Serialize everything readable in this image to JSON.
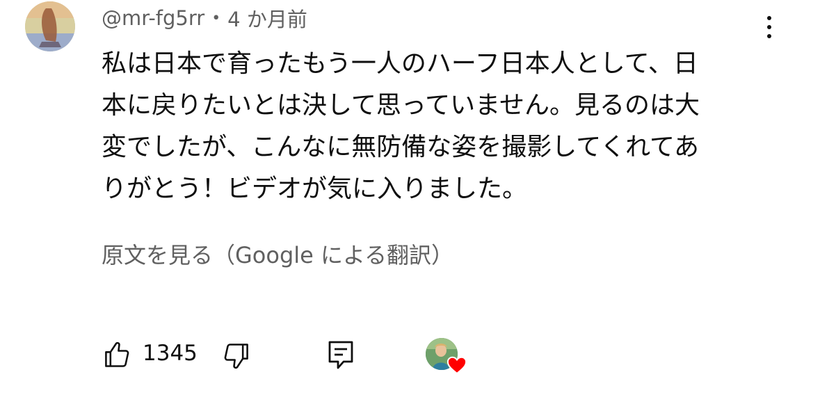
{
  "comment": {
    "author": "@mr-fg5rr",
    "separator": "•",
    "time": "4 か月前",
    "body_lines": [
      "私は日本で育ったもう一人のハーフ日本人として、日",
      "本に戻りたいとは決して思っていません。見るのは大",
      "変でしたが、こんなに無防備な姿を撮影してくれてあ",
      "りがとう！ビデオが気に入りました。"
    ],
    "translate_label": "原文を見る（Google による翻訳）"
  },
  "actions": {
    "like_count": "1345"
  },
  "icons": {
    "menu": "more-vert-icon",
    "like": "thumbs-up-icon",
    "dislike": "thumbs-down-icon",
    "reply": "reply-comment-icon",
    "creator_heart": "heart-icon"
  },
  "colors": {
    "text_primary": "#0f0f0f",
    "text_secondary": "#606060",
    "heart": "#ff0000"
  }
}
